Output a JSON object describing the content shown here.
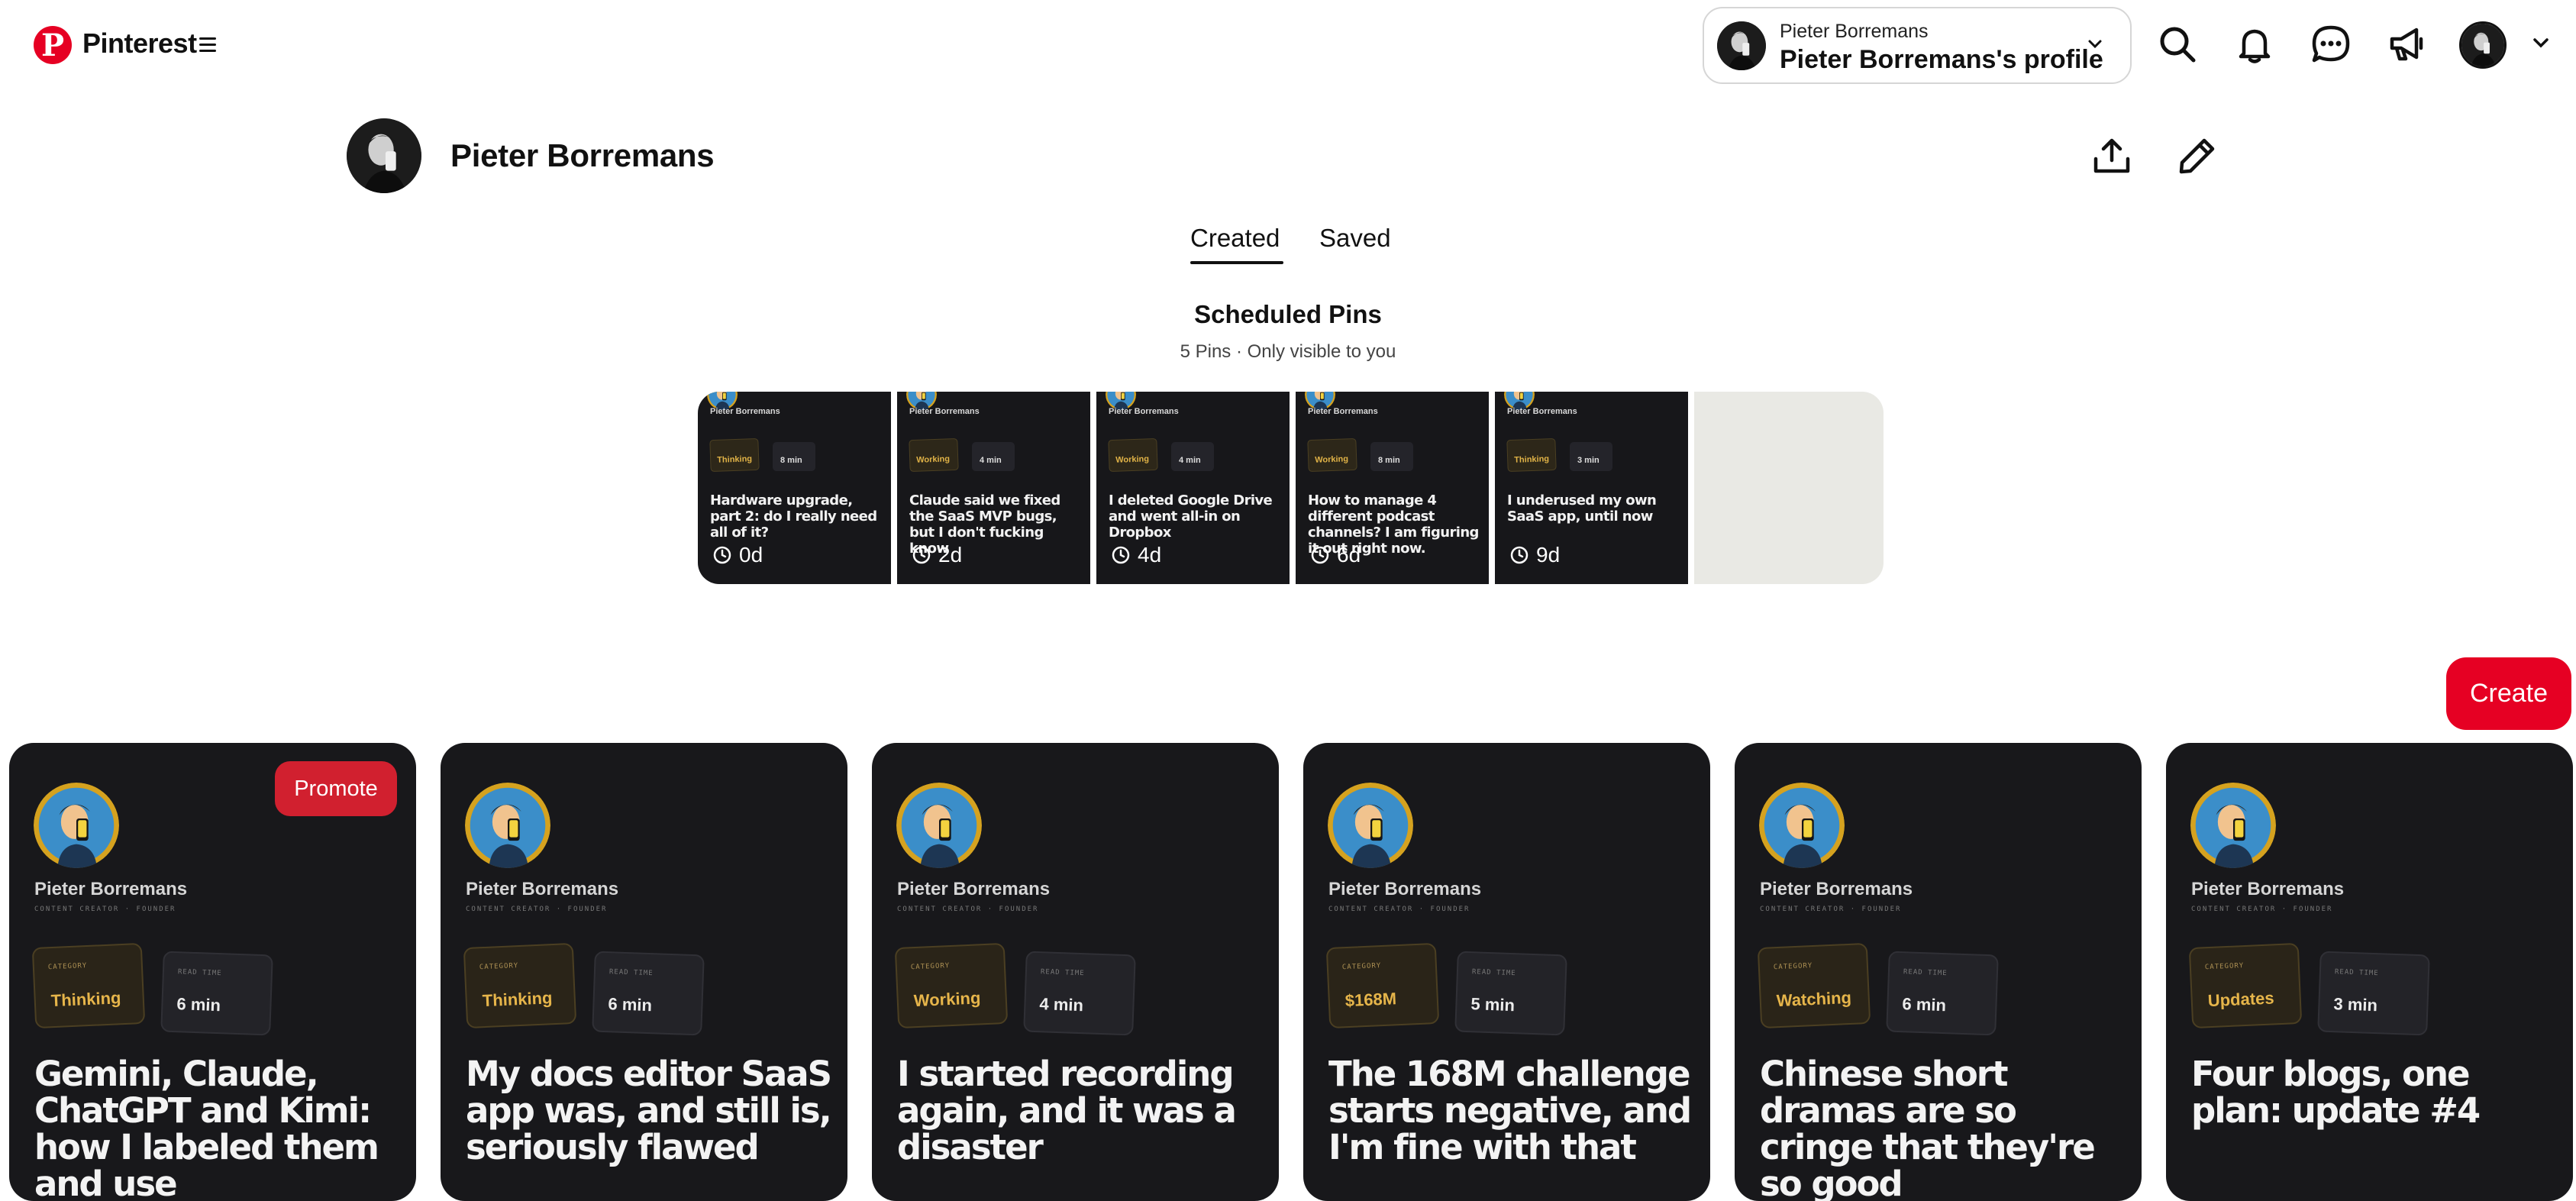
{
  "header": {
    "brand": "Pinterest",
    "account_switcher": {
      "account_name": "Pieter Borremans",
      "profile_label": "Pieter Borremans's profile"
    }
  },
  "profile": {
    "name": "Pieter Borremans",
    "tabs": [
      {
        "label": "Created",
        "active": true
      },
      {
        "label": "Saved",
        "active": false
      }
    ]
  },
  "scheduled": {
    "title": "Scheduled Pins",
    "subtitle": "5 Pins · Only visible to you",
    "pins": [
      {
        "author": "Pieter Borremans",
        "category": "Thinking",
        "read": "8 min",
        "title": "Hardware upgrade, part 2: do I really need all of it?",
        "time": "0d"
      },
      {
        "author": "Pieter Borremans",
        "category": "Working",
        "read": "4 min",
        "title": "Claude said we fixed the SaaS MVP bugs, but I don't fucking know",
        "time": "2d"
      },
      {
        "author": "Pieter Borremans",
        "category": "Working",
        "read": "4 min",
        "title": "I deleted Google Drive and went all-in on Dropbox",
        "time": "4d"
      },
      {
        "author": "Pieter Borremans",
        "category": "Working",
        "read": "8 min",
        "title": "How to manage 4 different podcast channels? I am figuring it out right now.",
        "time": "6d"
      },
      {
        "author": "Pieter Borremans",
        "category": "Thinking",
        "read": "3 min",
        "title": "I underused my own SaaS app, until now",
        "time": "9d"
      }
    ]
  },
  "create_label": "Create",
  "promote_label": "Promote",
  "pin_card_labels": {
    "role": "CONTENT CREATOR · FOUNDER",
    "category_key": "CATEGORY",
    "read_key": "READ TIME"
  },
  "pins": [
    {
      "author": "Pieter Borremans",
      "category": "Thinking",
      "read_time": "6 min",
      "title": "Gemini, Claude, ChatGPT and Kimi: how I labeled them and use"
    },
    {
      "author": "Pieter Borremans",
      "category": "Thinking",
      "read_time": "6 min",
      "title": "My docs editor SaaS app was, and still is, seriously flawed"
    },
    {
      "author": "Pieter Borremans",
      "category": "Working",
      "read_time": "4 min",
      "title": "I started recording again, and it was a disaster"
    },
    {
      "author": "Pieter Borremans",
      "category": "$168M",
      "read_time": "5 min",
      "title": "The 168M challenge starts negative, and I'm fine with that"
    },
    {
      "author": "Pieter Borremans",
      "category": "Watching",
      "read_time": "6 min",
      "title": "Chinese short dramas are so cringe that they're so good"
    },
    {
      "author": "Pieter Borremans",
      "category": "Updates",
      "read_time": "3 min",
      "title": "Four blogs, one plan: update #4"
    }
  ],
  "colors": {
    "brand_red": "#e60023",
    "card_bg": "#18181b",
    "category_gold": "#e6b54a"
  }
}
